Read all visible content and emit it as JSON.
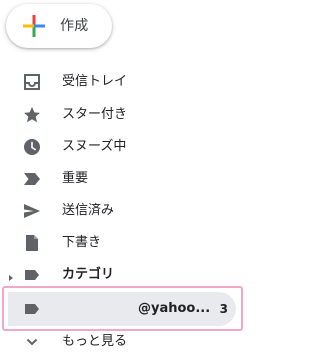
{
  "compose": {
    "label": "作成",
    "icon": "plus-icon"
  },
  "nav": {
    "items": [
      {
        "label": "受信トレイ",
        "icon": "inbox-icon"
      },
      {
        "label": "スター付き",
        "icon": "star-icon"
      },
      {
        "label": "スヌーズ中",
        "icon": "clock-icon"
      },
      {
        "label": "重要",
        "icon": "important-icon"
      },
      {
        "label": "送信済み",
        "icon": "send-icon"
      },
      {
        "label": "下書き",
        "icon": "draft-icon"
      },
      {
        "label": "カテゴリ",
        "icon": "label-icon"
      }
    ],
    "selected": {
      "label": "@yahoo...",
      "count": "3",
      "icon": "label-icon"
    },
    "more": {
      "label": "もっと見る",
      "icon": "chevron-down-icon"
    }
  },
  "colors": {
    "icon_gray": "#5f6368",
    "selected_bg": "#e8eaed",
    "highlight_border": "#f2a6c8",
    "plus_red": "#ea4335",
    "plus_blue": "#4285f4",
    "plus_green": "#34a853",
    "plus_yellow": "#fbbc04"
  }
}
